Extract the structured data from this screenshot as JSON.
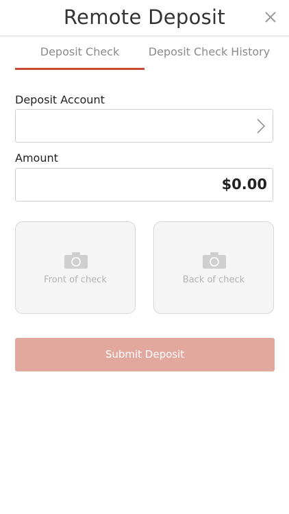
{
  "header": {
    "title": "Remote Deposit",
    "close_icon": "close-icon"
  },
  "tabs": [
    {
      "label": "Deposit Check",
      "active": true
    },
    {
      "label": "Deposit Check History",
      "active": false
    }
  ],
  "form": {
    "account": {
      "label": "Deposit Account",
      "value": ""
    },
    "amount": {
      "label": "Amount",
      "value": "$0.00"
    },
    "front": {
      "caption": "Front of check",
      "icon": "camera-icon"
    },
    "back": {
      "caption": "Back of check",
      "icon": "camera-icon"
    },
    "submit_label": "Submit Deposit"
  },
  "colors": {
    "accent": "#c44a35",
    "submit_disabled": "#e2a89d"
  }
}
